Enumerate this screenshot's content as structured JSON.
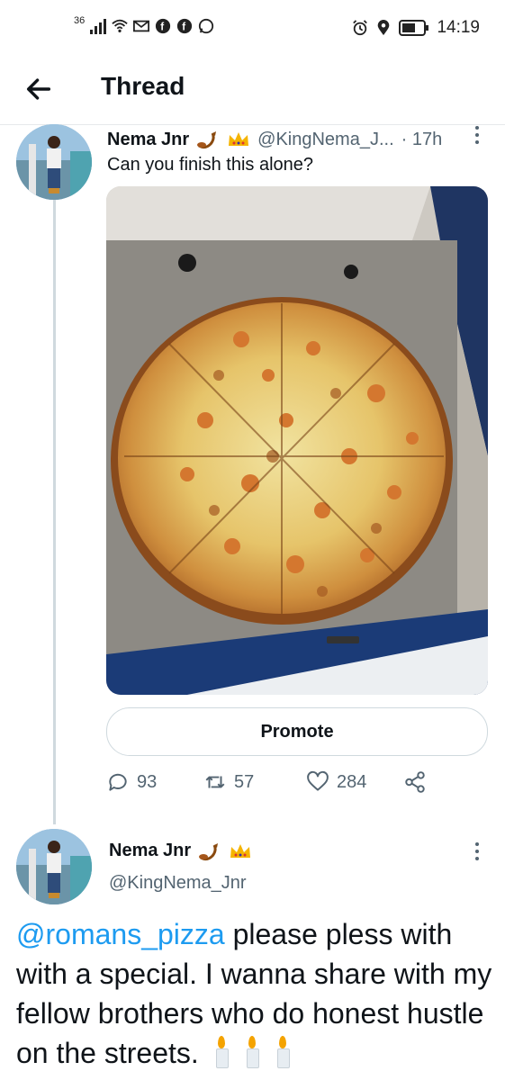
{
  "status_bar": {
    "network": "36",
    "time": "14:19"
  },
  "header": {
    "title": "Thread"
  },
  "tweet1": {
    "name": "Nema Jnr",
    "handle": "@KingNema_J...",
    "time": "· 17h",
    "text": "Can you finish this alone?",
    "promote_label": "Promote",
    "replies": "93",
    "retweets": "57",
    "likes": "284"
  },
  "tweet2": {
    "name": "Nema Jnr",
    "handle": "@KingNema_Jnr",
    "mention": "@romans_pizza",
    "text_rest": " please pless with with a special. I wanna share with my fellow brothers who do honest hustle on the streets."
  },
  "icons": [
    "back-arrow-icon",
    "reply-icon",
    "retweet-icon",
    "like-icon",
    "share-icon",
    "more-options-icon",
    "scorpion-emoji-icon",
    "crown-emoji-icon",
    "candle-emoji-icon"
  ],
  "colors": {
    "accent": "#1d9bf0",
    "text": "#0f1419",
    "secondary": "#536471",
    "divider": "#cfd9de"
  }
}
